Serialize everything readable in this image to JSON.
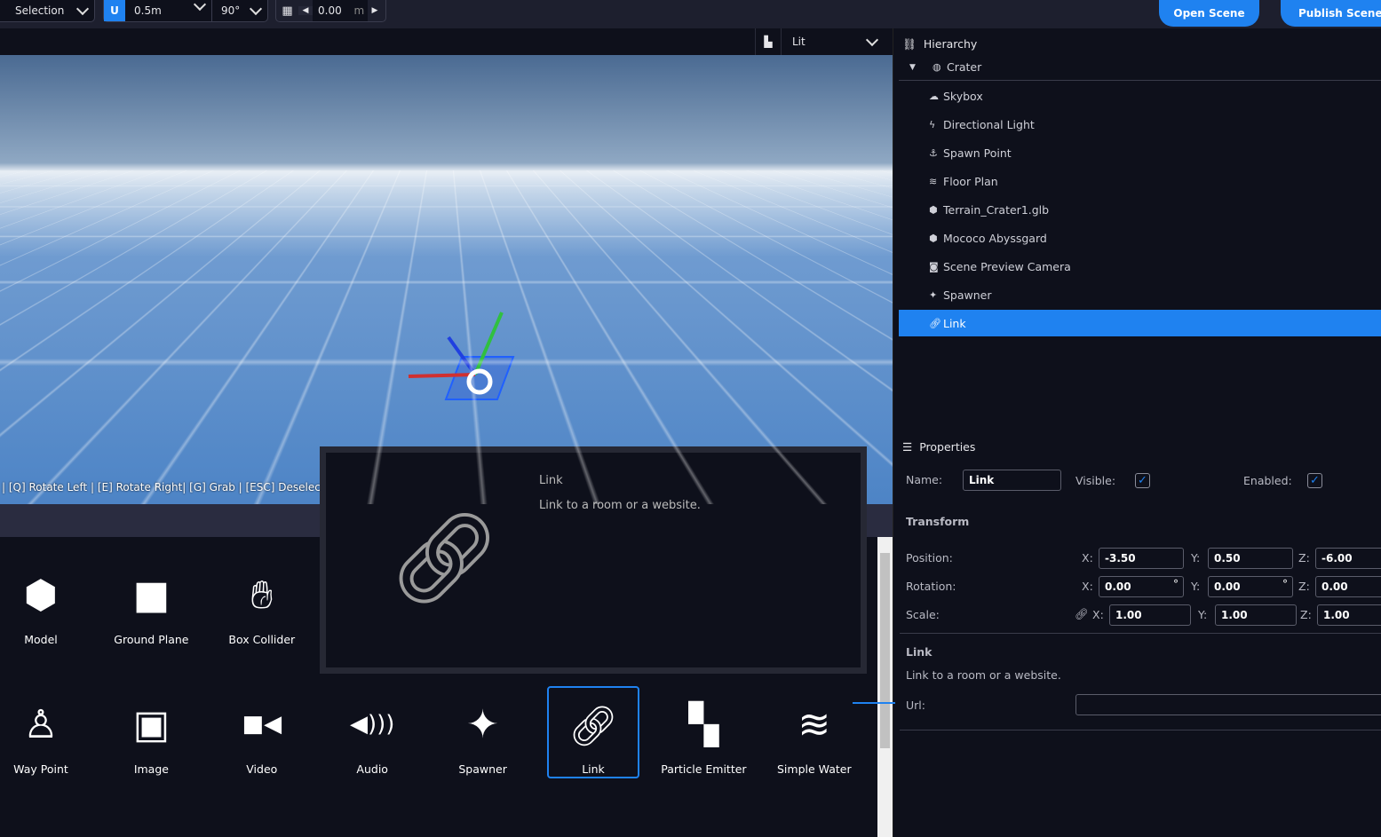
{
  "toolbar": {
    "mode": "Selection",
    "snap_distance": "0.5m",
    "snap_angle": "90°",
    "grid_height": "0.00",
    "grid_unit": "m",
    "open_scene": "Open Scene",
    "publish_scene": "Publish Scene..."
  },
  "viewport": {
    "render_mode": "Lit",
    "hints": "| [Q] Rotate Left | [E] Rotate Right| [G] Grab | [ESC] Deselect A"
  },
  "hierarchy": {
    "title": "Hierarchy",
    "root": "Crater",
    "items": [
      {
        "label": "Skybox",
        "icon": "cloud-icon"
      },
      {
        "label": "Directional Light",
        "icon": "bolt-icon"
      },
      {
        "label": "Spawn Point",
        "icon": "anchor-icon"
      },
      {
        "label": "Floor Plan",
        "icon": "shoe-prints-icon"
      },
      {
        "label": "Terrain_Crater1.glb",
        "icon": "cube-icon"
      },
      {
        "label": "Mococo Abyssgard",
        "icon": "cube-icon"
      },
      {
        "label": "Scene Preview Camera",
        "icon": "camera-icon"
      },
      {
        "label": "Spawner",
        "icon": "magic-icon"
      },
      {
        "label": "Link",
        "icon": "link-icon",
        "selected": true
      }
    ]
  },
  "properties": {
    "title": "Properties",
    "name_label": "Name:",
    "name": "Link",
    "visible_label": "Visible:",
    "visible": true,
    "enabled_label": "Enabled:",
    "enabled": true,
    "transform_title": "Transform",
    "position_label": "Position:",
    "position": {
      "x": "-3.50",
      "y": "0.50",
      "z": "-6.00"
    },
    "rotation_label": "Rotation:",
    "rotation": {
      "x": "0.00",
      "y": "0.00",
      "z": "0.00"
    },
    "scale_label": "Scale:",
    "scale": {
      "x": "1.00",
      "y": "1.00",
      "z": "1.00"
    },
    "x": "X:",
    "y": "Y:",
    "z": "Z:",
    "deg": "°",
    "link_title": "Link",
    "link_desc": "Link to a room or a website.",
    "url_label": "Url:",
    "url": ""
  },
  "tooltip": {
    "title": "Link",
    "desc": "Link to a room or a website."
  },
  "assets": [
    {
      "label": "Model",
      "icon": "cube-icon"
    },
    {
      "label": "Ground Plane",
      "icon": "square-icon"
    },
    {
      "label": "Box Collider",
      "icon": "hand-icon"
    },
    {
      "label": "Way Point",
      "icon": "street-view-icon"
    },
    {
      "label": "Image",
      "icon": "image-icon"
    },
    {
      "label": "Video",
      "icon": "video-icon"
    },
    {
      "label": "Audio",
      "icon": "volume-icon"
    },
    {
      "label": "Spawner",
      "icon": "magic-icon"
    },
    {
      "label": "Link",
      "icon": "link-icon",
      "selected": true
    },
    {
      "label": "Particle Emitter",
      "icon": "spray-can-icon"
    },
    {
      "label": "Simple Water",
      "icon": "water-icon"
    }
  ],
  "colors": {
    "accent": "#1f82f0",
    "background": "#0e101b"
  }
}
